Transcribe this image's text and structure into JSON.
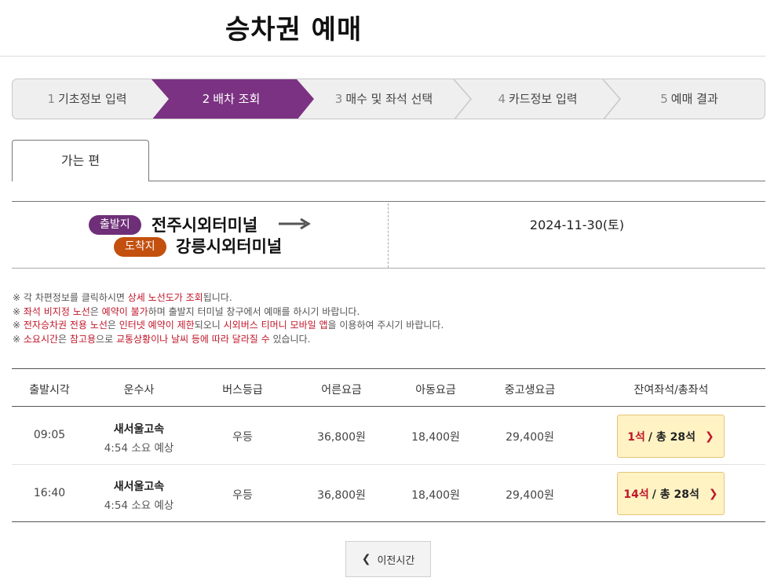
{
  "page": {
    "title": "승차권 예매"
  },
  "steps": [
    {
      "num": "1",
      "label": "기초정보 입력",
      "active": false
    },
    {
      "num": "2",
      "label": "배차 조회",
      "active": true
    },
    {
      "num": "3",
      "label": "매수 및 좌석 선택",
      "active": false
    },
    {
      "num": "4",
      "label": "카드정보 입력",
      "active": false
    },
    {
      "num": "5",
      "label": "예매 결과",
      "active": false
    }
  ],
  "tabs": [
    {
      "label": "가는 편",
      "selected": true
    }
  ],
  "route": {
    "departure_badge": "출발지",
    "departure": "전주시외터미널",
    "arrival_badge": "도착지",
    "arrival": "강릉시외터미널",
    "date": "2024-11-30(토)"
  },
  "notes": [
    [
      {
        "t": "※ 각 차편정보를 클릭하시면 ",
        "red": false
      },
      {
        "t": "상세 노선도가 조회",
        "red": true
      },
      {
        "t": "됩니다.",
        "red": false
      }
    ],
    [
      {
        "t": "※ ",
        "red": false
      },
      {
        "t": "좌석 비지정 노선",
        "red": true
      },
      {
        "t": "은 ",
        "red": false
      },
      {
        "t": "예약이 불가",
        "red": true
      },
      {
        "t": "하며 출발지 터미널 창구에서 예매를 하시기 바랍니다.",
        "red": false
      }
    ],
    [
      {
        "t": "※ ",
        "red": false
      },
      {
        "t": "전자승차권 전용 노선",
        "red": true
      },
      {
        "t": "은 ",
        "red": false
      },
      {
        "t": "인터넷 예약이 제한",
        "red": true
      },
      {
        "t": "되오니 ",
        "red": false
      },
      {
        "t": "시외버스 티머니 모바일 앱",
        "red": true
      },
      {
        "t": "을 이용하여 주시기 바랍니다.",
        "red": false
      }
    ],
    [
      {
        "t": "※ ",
        "red": false
      },
      {
        "t": "소요시간",
        "red": true
      },
      {
        "t": "은 ",
        "red": false
      },
      {
        "t": "참고용",
        "red": true
      },
      {
        "t": "으로 ",
        "red": false
      },
      {
        "t": "교통상황이나 날씨 등에 따라 달라질 수",
        "red": true
      },
      {
        "t": " 있습니다.",
        "red": false
      }
    ]
  ],
  "table": {
    "headers": {
      "time": "출발시각",
      "carrier": "운수사",
      "grade": "버스등급",
      "adult": "어른요금",
      "child": "아동요금",
      "teen": "중고생요금",
      "seats": "잔여좌석/총좌석"
    },
    "rows": [
      {
        "time": "09:05",
        "carrier": "새서울고속",
        "duration": "4:54 소요 예상",
        "grade": "우등",
        "adult": "36,800원",
        "child": "18,400원",
        "teen": "29,400원",
        "remaining": "1석",
        "total": "/ 총 28석"
      },
      {
        "time": "16:40",
        "carrier": "새서울고속",
        "duration": "4:54 소요 예상",
        "grade": "우등",
        "adult": "36,800원",
        "child": "18,400원",
        "teen": "29,400원",
        "remaining": "14석",
        "total": "/ 총 28석"
      }
    ]
  },
  "prev_button": {
    "label": "이전시간"
  },
  "colors": {
    "accent": "#7b3282",
    "departure_badge": "#6e2f78",
    "arrival_badge": "#c3500f",
    "highlight": "#c0172a",
    "seat_button_bg": "#fff3c4"
  }
}
